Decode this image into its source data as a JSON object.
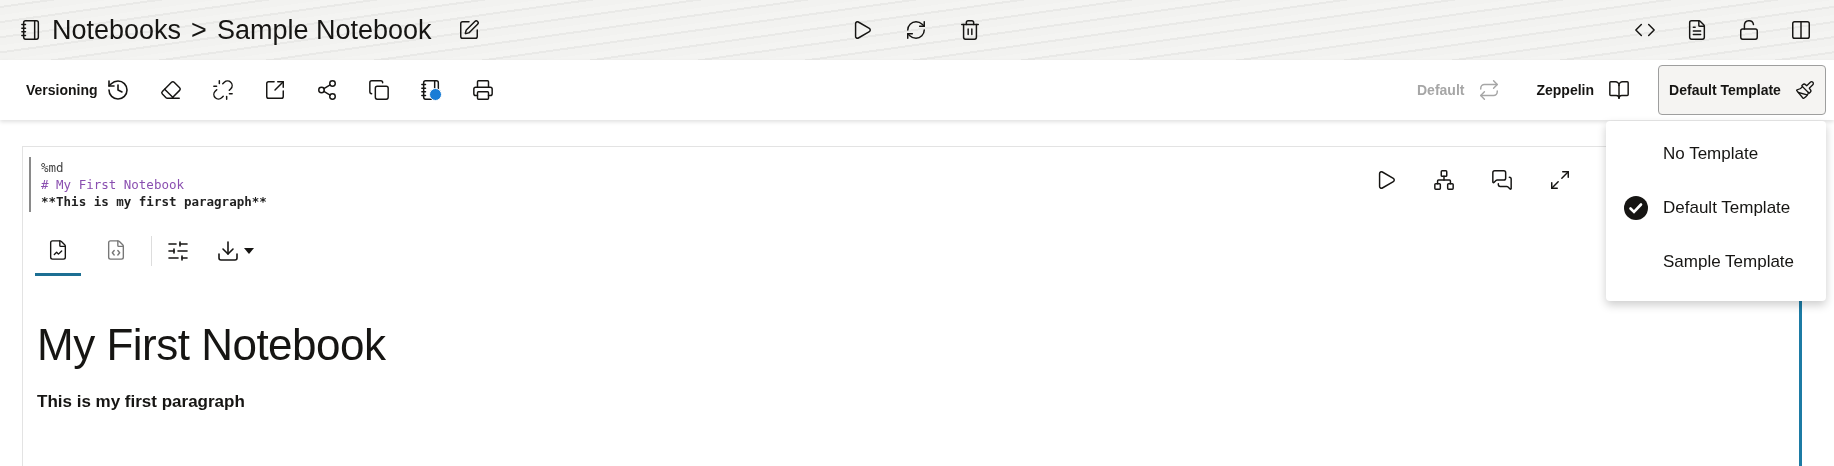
{
  "header": {
    "breadcrumb": [
      "Notebooks",
      ">",
      "Sample Notebook"
    ]
  },
  "toolbar": {
    "versioning_label": "Versioning",
    "interpreter": {
      "label": "Default",
      "disabled": true
    },
    "zeppelin_label": "Zeppelin",
    "template_button": "Default Template"
  },
  "template_menu": {
    "items": [
      {
        "label": "No Template",
        "selected": false
      },
      {
        "label": "Default Template",
        "selected": true
      },
      {
        "label": "Sample Template",
        "selected": false
      }
    ]
  },
  "paragraph": {
    "code_lines": [
      {
        "kind": "directive",
        "text": "%md"
      },
      {
        "kind": "heading",
        "text": "# My First Notebook"
      },
      {
        "kind": "bold",
        "text": "**This is my first paragraph**"
      }
    ],
    "output_tabs": [
      {
        "kind": "chart",
        "selected": true
      },
      {
        "kind": "code",
        "selected": false
      }
    ],
    "output": {
      "heading": "My First Notebook",
      "text": "This is my first paragraph"
    }
  }
}
